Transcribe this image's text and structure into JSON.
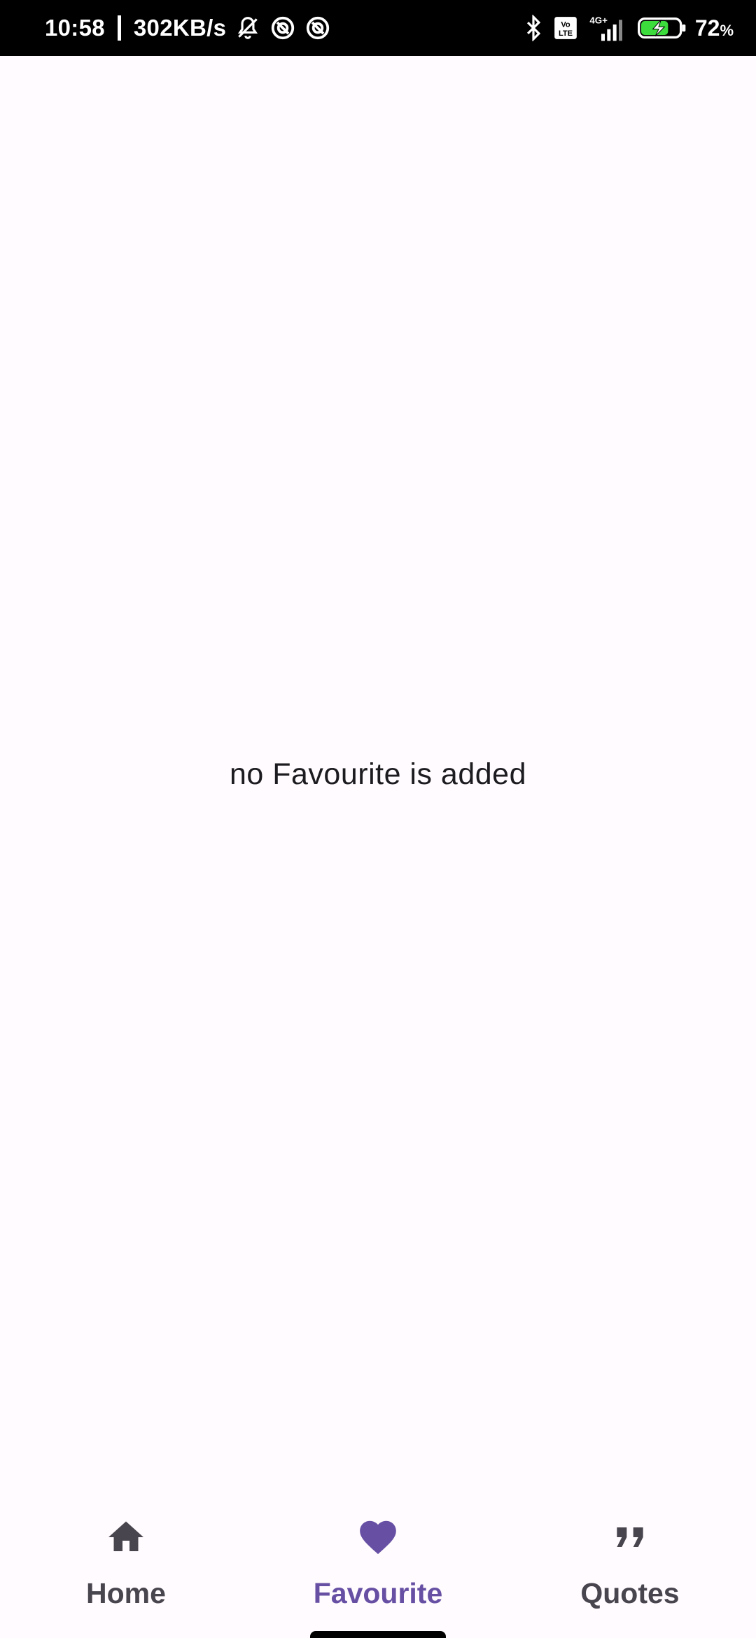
{
  "status_bar": {
    "time": "10:58",
    "net_speed": "302KB/s",
    "network": "4G+",
    "volte": "Vo LTE",
    "battery_percent": "72",
    "battery_unit": "%",
    "battery_level": 0.72,
    "icons": [
      "mute-bell-icon",
      "sync-icon",
      "sync-icon",
      "bluetooth-icon",
      "volte-icon",
      "signal-icon",
      "battery-charging-icon"
    ]
  },
  "main": {
    "empty_message": "no Favourite is added"
  },
  "bottom_nav": {
    "items": [
      {
        "label": "Home",
        "icon": "home-icon",
        "active": false
      },
      {
        "label": "Favourite",
        "icon": "heart-icon",
        "active": true
      },
      {
        "label": "Quotes",
        "icon": "quote-icon",
        "active": false
      }
    ],
    "active_color": "#6750a4",
    "inactive_color": "#49454f"
  }
}
